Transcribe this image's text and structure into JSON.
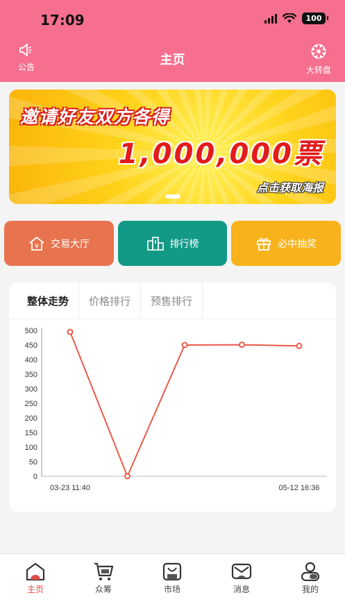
{
  "status": {
    "time": "17:09",
    "battery": "100"
  },
  "nav": {
    "title": "主页",
    "left_label": "公告",
    "right_label": "大转盘"
  },
  "banner": {
    "line1": "邀请好友双方各得",
    "line2": "1,000,000票",
    "cta": "点击获取海报"
  },
  "quick_actions": [
    {
      "label": "交易大厅",
      "icon": "yuan-house-icon"
    },
    {
      "label": "排行榜",
      "icon": "ranking-icon"
    },
    {
      "label": "必中抽奖",
      "icon": "gift-icon"
    }
  ],
  "tabs": [
    {
      "label": "整体走势",
      "active": true
    },
    {
      "label": "价格排行",
      "active": false
    },
    {
      "label": "预售排行",
      "active": false
    }
  ],
  "chart_data": {
    "type": "line",
    "x": [
      "03-23 11:40",
      "",
      "",
      "",
      "05-12 16:36"
    ],
    "values": [
      495,
      0,
      450,
      451,
      447
    ],
    "yticks": [
      0,
      50,
      100,
      150,
      200,
      250,
      300,
      350,
      400,
      450,
      500
    ],
    "ylim": [
      0,
      500
    ],
    "x_tick_labels": [
      "03-23 11:40",
      "05-12 16:36"
    ],
    "line_color": "#e85a4a",
    "grid": false
  },
  "bottom_tabs": [
    {
      "label": "主页",
      "icon": "home-icon",
      "active": true
    },
    {
      "label": "众筹",
      "icon": "cart-icon",
      "active": false
    },
    {
      "label": "市场",
      "icon": "market-icon",
      "active": false
    },
    {
      "label": "消息",
      "icon": "message-icon",
      "active": false
    },
    {
      "label": "我的",
      "icon": "profile-icon",
      "active": false
    }
  ],
  "colors": {
    "header": "#f66f8f",
    "accent": "#e34a4a",
    "trade": "#e8744f",
    "rank": "#129a86",
    "lottery": "#f8b21b"
  }
}
